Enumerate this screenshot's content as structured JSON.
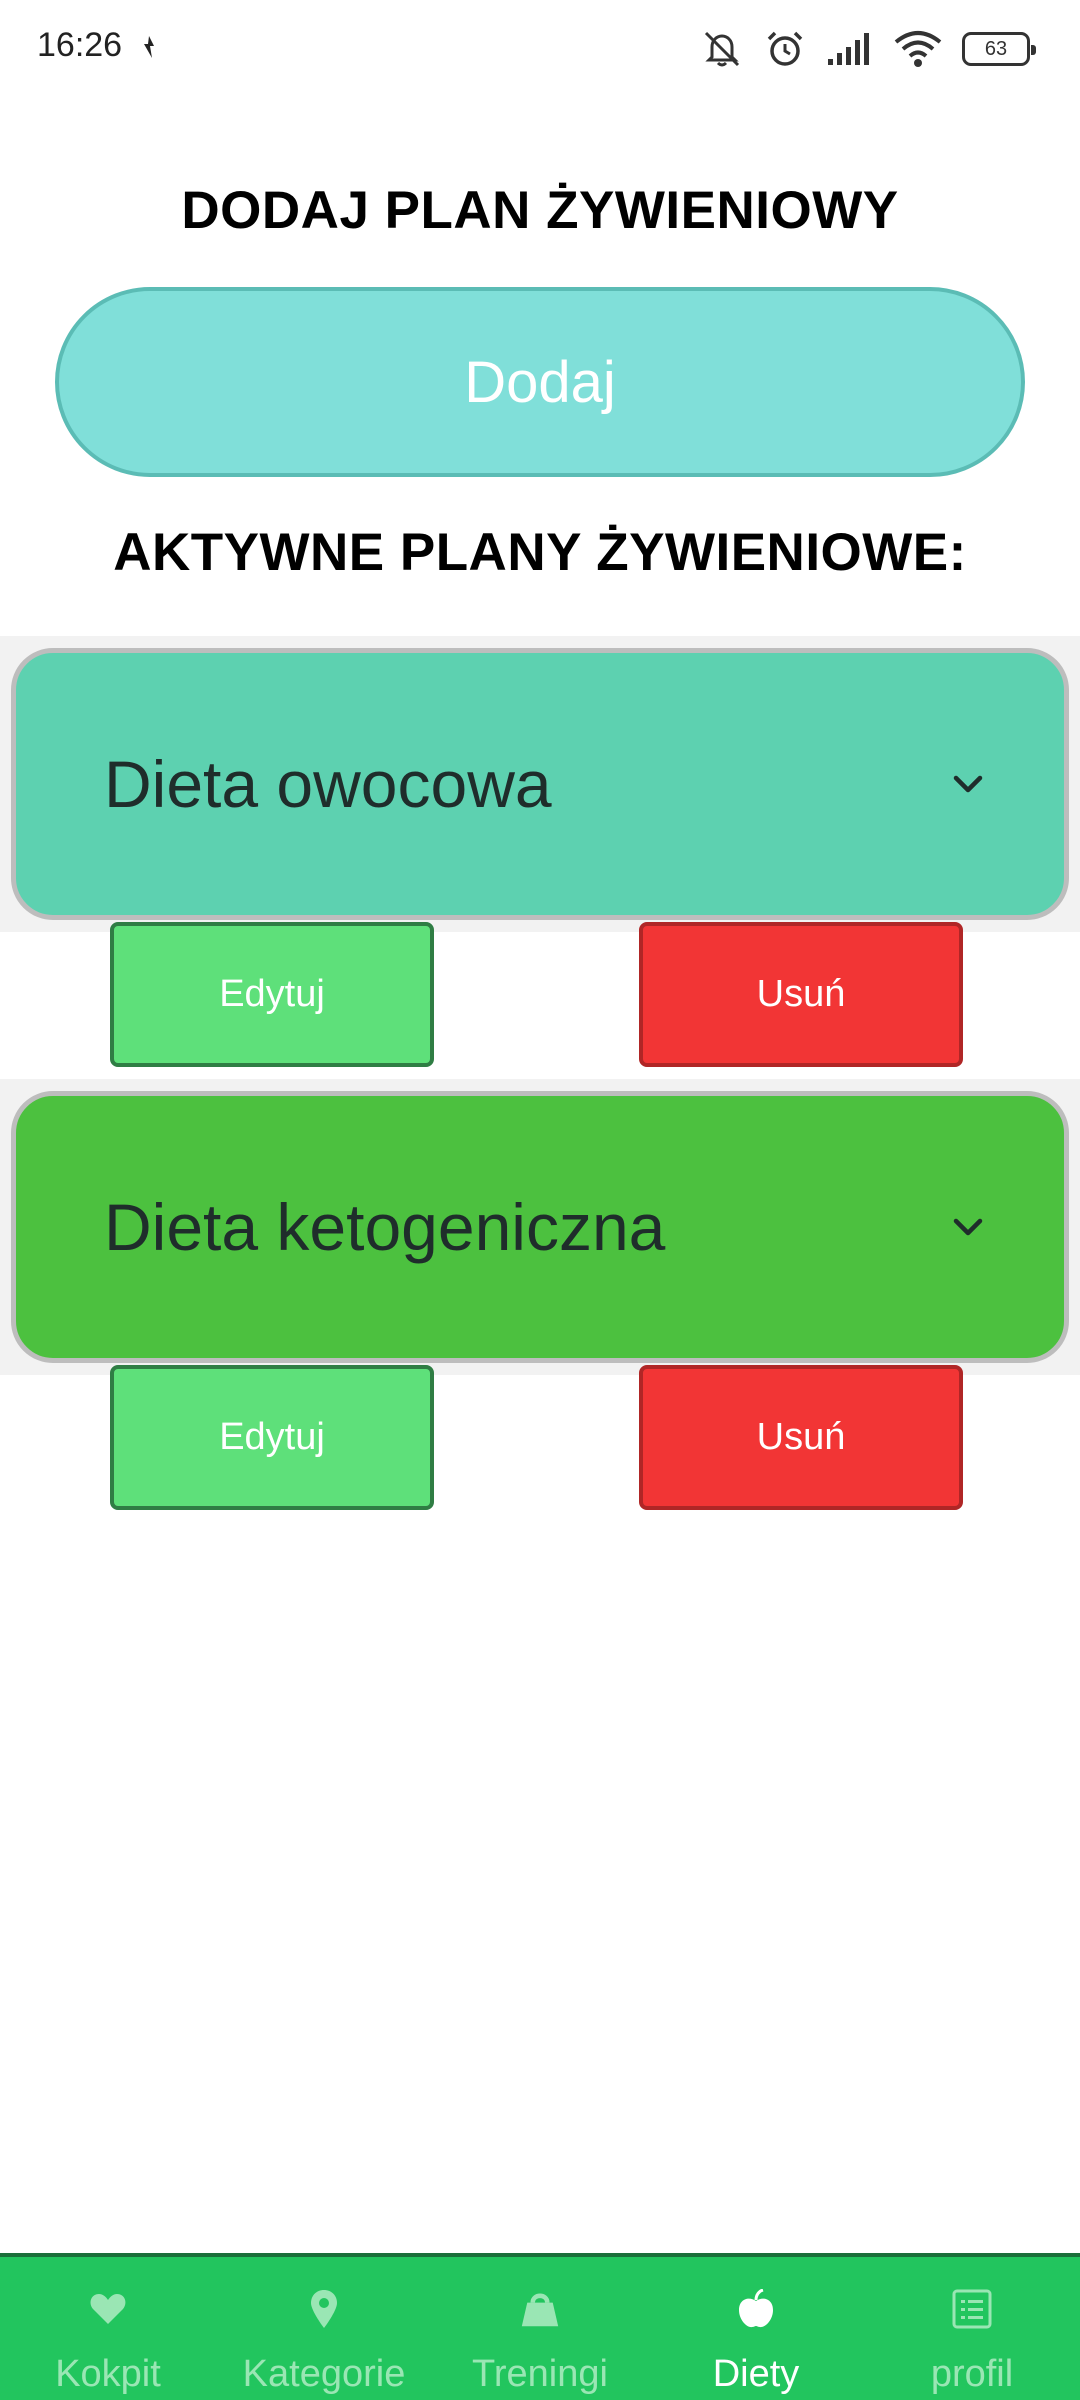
{
  "status_bar": {
    "time": "16:26",
    "battery": "63"
  },
  "add_section": {
    "heading": "DODAJ PLAN ŻYWIENIOWY",
    "button_label": "Dodaj",
    "button_color": "#80dfd9"
  },
  "active_section": {
    "heading": "AKTYWNE PLANY ŻYWIENIOWE:"
  },
  "plans": [
    {
      "title": "Dieta owocowa",
      "color": "#5dd1b0",
      "edit_label": "Edytuj",
      "delete_label": "Usuń"
    },
    {
      "title": "Dieta ketogeniczna",
      "color": "#4cc13f",
      "edit_label": "Edytuj",
      "delete_label": "Usuń"
    }
  ],
  "bottom_nav": {
    "items": [
      {
        "label": "Kokpit",
        "icon": "heart-icon"
      },
      {
        "label": "Kategorie",
        "icon": "map-pin-icon"
      },
      {
        "label": "Treningi",
        "icon": "kettlebell-icon"
      },
      {
        "label": "Diety",
        "icon": "apple-icon"
      },
      {
        "label": "profil",
        "icon": "list-icon"
      }
    ],
    "active": "Diety"
  },
  "colors": {
    "edit": "#5ee07a",
    "delete": "#f23535",
    "nav": "#22c55e"
  }
}
